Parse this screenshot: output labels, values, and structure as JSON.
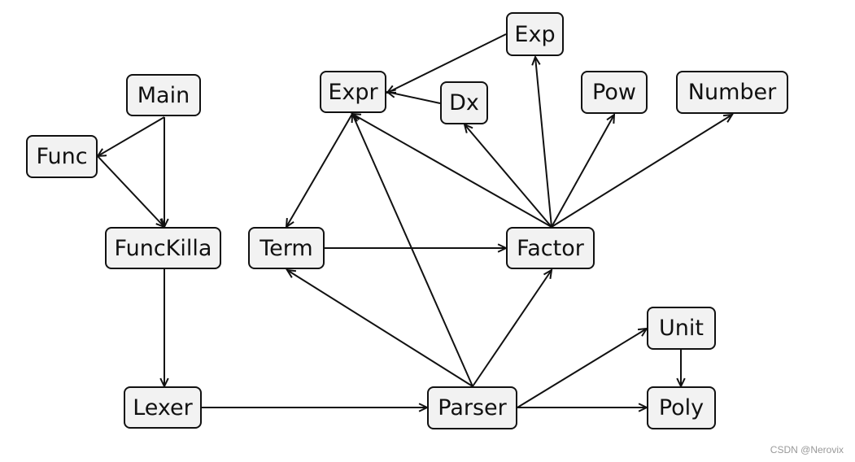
{
  "nodes": [
    {
      "id": "main",
      "label": "Main"
    },
    {
      "id": "func",
      "label": "Func"
    },
    {
      "id": "funckilla",
      "label": "FuncKilla"
    },
    {
      "id": "lexer",
      "label": "Lexer"
    },
    {
      "id": "expr",
      "label": "Expr"
    },
    {
      "id": "exp",
      "label": "Exp"
    },
    {
      "id": "dx",
      "label": "Dx"
    },
    {
      "id": "pow",
      "label": "Pow"
    },
    {
      "id": "number",
      "label": "Number"
    },
    {
      "id": "term",
      "label": "Term"
    },
    {
      "id": "factor",
      "label": "Factor"
    },
    {
      "id": "unit",
      "label": "Unit"
    },
    {
      "id": "parser",
      "label": "Parser"
    },
    {
      "id": "poly",
      "label": "Poly"
    }
  ],
  "edges": [
    {
      "from": "main",
      "to": "func"
    },
    {
      "from": "main",
      "to": "funckilla"
    },
    {
      "from": "func",
      "to": "funckilla"
    },
    {
      "from": "funckilla",
      "to": "lexer"
    },
    {
      "from": "lexer",
      "to": "parser"
    },
    {
      "from": "exp",
      "to": "expr"
    },
    {
      "from": "dx",
      "to": "expr"
    },
    {
      "from": "expr",
      "to": "term"
    },
    {
      "from": "factor",
      "to": "expr"
    },
    {
      "from": "parser",
      "to": "expr"
    },
    {
      "from": "parser",
      "to": "term"
    },
    {
      "from": "parser",
      "to": "factor"
    },
    {
      "from": "term",
      "to": "factor"
    },
    {
      "from": "factor",
      "to": "dx"
    },
    {
      "from": "factor",
      "to": "exp"
    },
    {
      "from": "factor",
      "to": "pow"
    },
    {
      "from": "factor",
      "to": "number"
    },
    {
      "from": "parser",
      "to": "unit"
    },
    {
      "from": "parser",
      "to": "poly"
    },
    {
      "from": "unit",
      "to": "poly"
    }
  ],
  "watermark": "CSDN @Nerovix"
}
